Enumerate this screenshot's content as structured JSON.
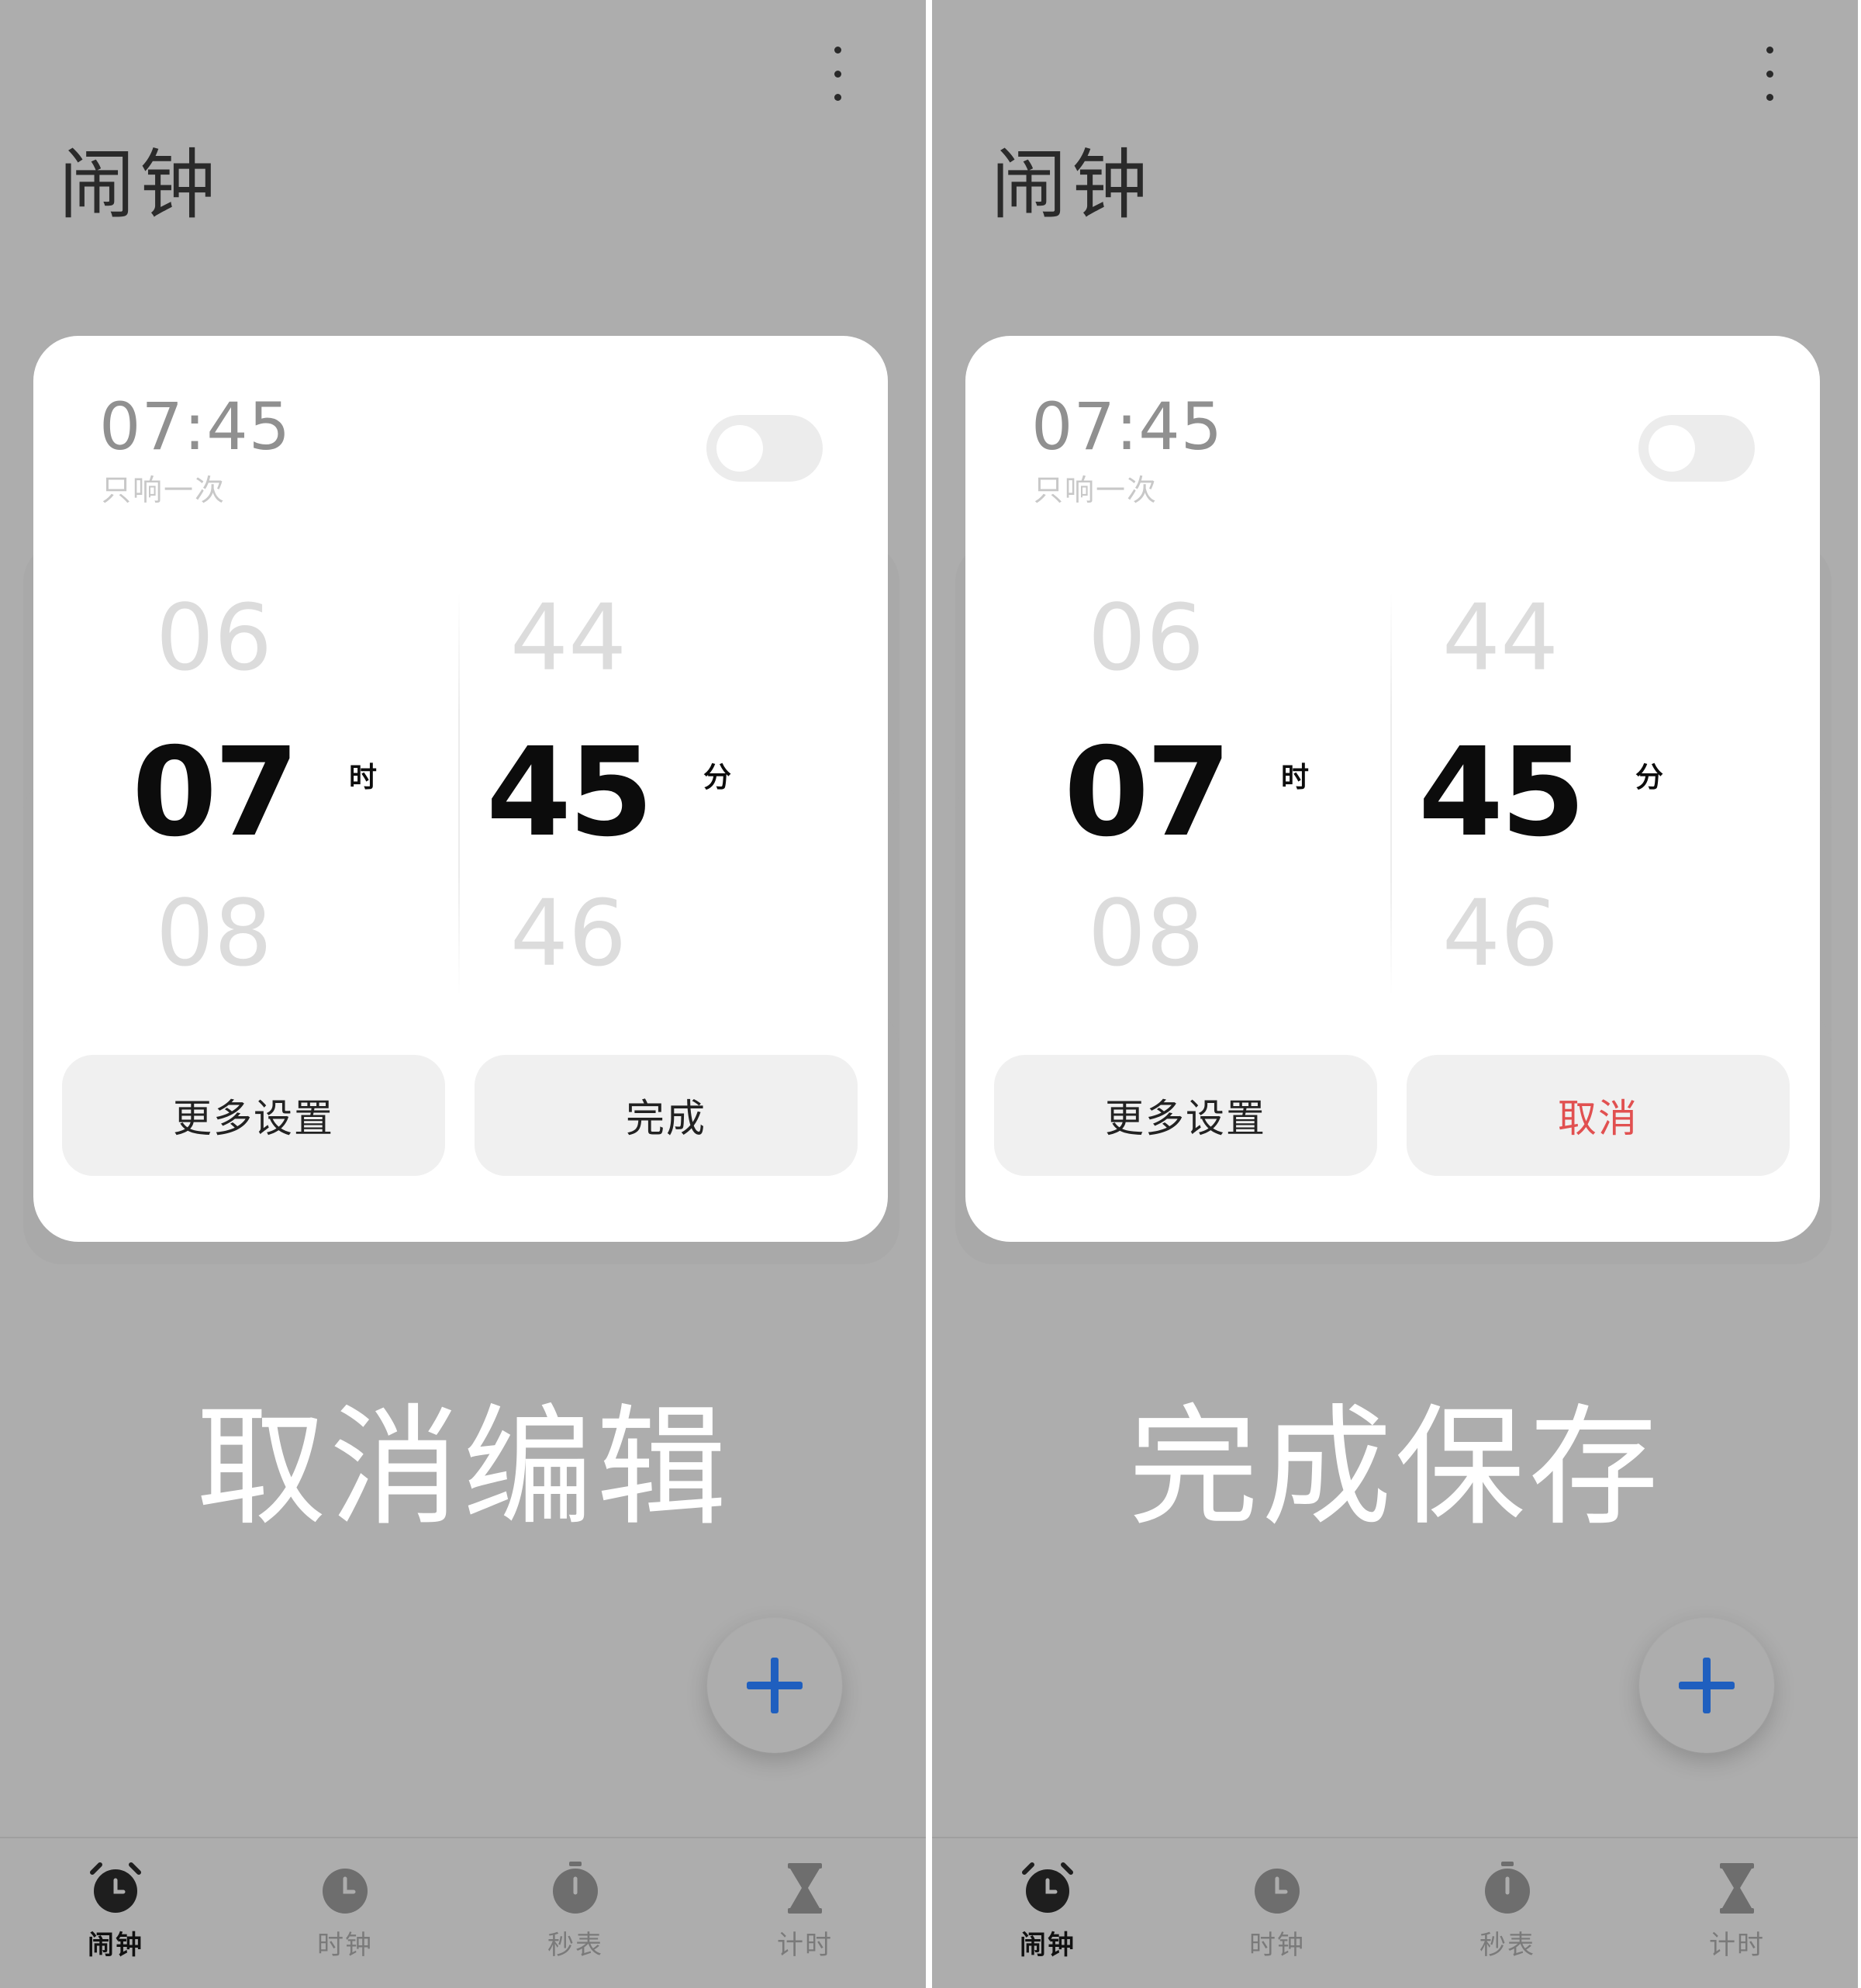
{
  "panels": [
    {
      "page_title": "闹钟",
      "alarm": {
        "time": "07:45",
        "repeat": "只响一次",
        "enabled": false
      },
      "picker": {
        "hour_prev": "06",
        "hour": "07",
        "hour_next": "08",
        "hour_unit": "时",
        "minute_prev": "44",
        "minute": "45",
        "minute_next": "46",
        "minute_unit": "分"
      },
      "buttons": {
        "more": "更多设置",
        "confirm": "完成"
      },
      "caption": "取消编辑",
      "nav": [
        {
          "label": "闹钟",
          "icon": "alarm-icon",
          "active": true
        },
        {
          "label": "时钟",
          "icon": "clock-icon",
          "active": false
        },
        {
          "label": "秒表",
          "icon": "stopwatch-icon",
          "active": false
        },
        {
          "label": "计时",
          "icon": "hourglass-icon",
          "active": false
        }
      ]
    },
    {
      "page_title": "闹钟",
      "alarm": {
        "time": "07:45",
        "repeat": "只响一次",
        "enabled": false
      },
      "picker": {
        "hour_prev": "06",
        "hour": "07",
        "hour_next": "08",
        "hour_unit": "时",
        "minute_prev": "44",
        "minute": "45",
        "minute_next": "46",
        "minute_unit": "分"
      },
      "buttons": {
        "more": "更多设置",
        "cancel": "取消"
      },
      "caption": "完成保存",
      "nav": [
        {
          "label": "闹钟",
          "icon": "alarm-icon",
          "active": true
        },
        {
          "label": "时钟",
          "icon": "clock-icon",
          "active": false
        },
        {
          "label": "秒表",
          "icon": "stopwatch-icon",
          "active": false
        },
        {
          "label": "计时",
          "icon": "hourglass-icon",
          "active": false
        }
      ]
    }
  ],
  "colors": {
    "background": "#adadad",
    "card": "#ffffff",
    "accent_fab": "#1f5fbf",
    "cancel_text": "#e15050",
    "active_icon": "#1e1e1e",
    "inactive_icon": "#6e6e6e"
  }
}
